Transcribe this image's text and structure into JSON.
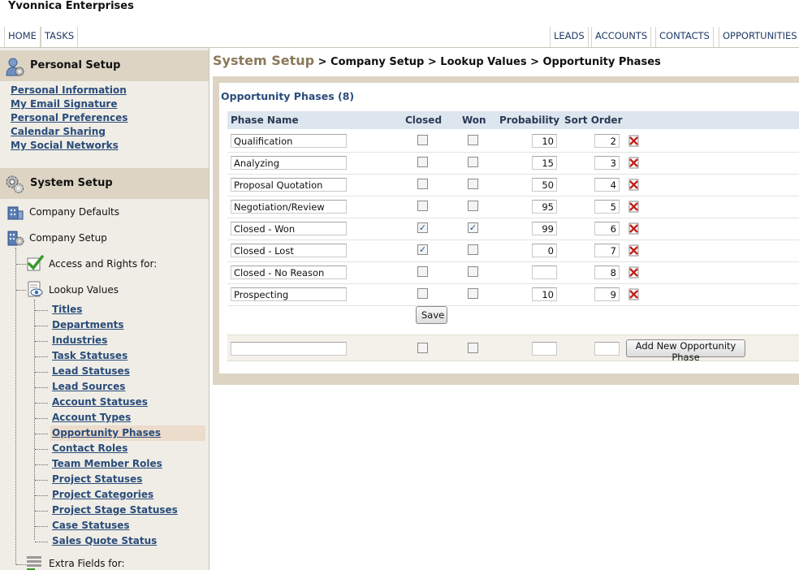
{
  "app": {
    "brand": "Yvonnica Enterprises"
  },
  "topnav": {
    "left": [
      {
        "label": "HOME"
      },
      {
        "label": "TASKS"
      }
    ],
    "right": [
      {
        "label": "LEADS"
      },
      {
        "label": "ACCOUNTS"
      },
      {
        "label": "CONTACTS"
      },
      {
        "label": "OPPORTUNITIES"
      }
    ]
  },
  "sidebar": {
    "personal": {
      "title": "Personal Setup",
      "links": [
        "Personal Information",
        "My Email Signature",
        "Personal Preferences",
        "Calendar Sharing",
        "My Social Networks"
      ]
    },
    "system": {
      "title": "System Setup",
      "company_defaults": "Company Defaults",
      "company_setup": "Company Setup",
      "access_rights": "Access and Rights for:",
      "lookup_values": "Lookup Values",
      "lookup_links": [
        "Titles",
        "Departments",
        "Industries",
        "Task Statuses",
        "Lead Statuses",
        "Lead Sources",
        "Account Statuses",
        "Account Types",
        "Opportunity Phases",
        "Contact Roles",
        "Team Member Roles",
        "Project Statuses",
        "Project Categories",
        "Project Stage Statuses",
        "Case Statuses",
        "Sales Quote Status"
      ],
      "active_link": "Opportunity Phases",
      "extra_fields": "Extra Fields for:"
    }
  },
  "breadcrumb": {
    "head": "System Setup",
    "rest": " > Company Setup > Lookup Values > Opportunity Phases"
  },
  "panel": {
    "title": "Opportunity Phases (8)",
    "columns": [
      "Phase Name",
      "Closed",
      "Won",
      "Probability",
      "Sort Order"
    ],
    "rows": [
      {
        "name": "Qualification",
        "closed": false,
        "won": false,
        "probability": "10",
        "sort": "2"
      },
      {
        "name": "Analyzing",
        "closed": false,
        "won": false,
        "probability": "15",
        "sort": "3"
      },
      {
        "name": "Proposal Quotation",
        "closed": false,
        "won": false,
        "probability": "50",
        "sort": "4"
      },
      {
        "name": "Negotiation/Review",
        "closed": false,
        "won": false,
        "probability": "95",
        "sort": "5"
      },
      {
        "name": "Closed - Won",
        "closed": true,
        "won": true,
        "probability": "99",
        "sort": "6"
      },
      {
        "name": "Closed - Lost",
        "closed": true,
        "won": false,
        "probability": "0",
        "sort": "7"
      },
      {
        "name": "Closed - No Reason",
        "closed": false,
        "won": false,
        "probability": "",
        "sort": "8"
      },
      {
        "name": "Prospecting",
        "closed": false,
        "won": false,
        "probability": "10",
        "sort": "9"
      }
    ],
    "save_label": "Save",
    "add_label": "Add New Opportunity Phase",
    "new_row": {
      "name": "",
      "probability": "",
      "sort": ""
    }
  },
  "colors": {
    "link": "#2a4c7a",
    "section_bg": "#ddd4c4",
    "grid_head_bg": "#dde6ef",
    "delete_red": "#c0221b"
  },
  "icons": {
    "personal": "person-gear-icon",
    "system": "gears-icon",
    "company_defaults": "building-icon",
    "company_setup": "building-gear-icon",
    "access": "checkmark-icon",
    "lookup": "eye-document-icon",
    "extra": "list-add-icon",
    "delete": "delete-x-icon"
  }
}
